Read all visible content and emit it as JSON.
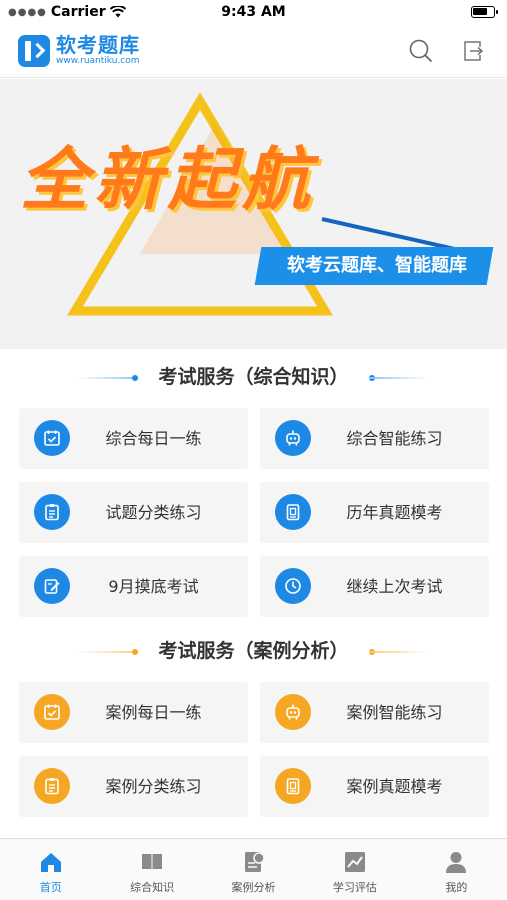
{
  "status_bar": {
    "carrier": "Carrier",
    "time": "9:43 AM"
  },
  "header": {
    "app_name": "软考题库",
    "app_url": "www.ruantiku.com"
  },
  "banner": {
    "headline": "全新起航",
    "subtitle": "软考云题库、智能题库"
  },
  "colors": {
    "brand_blue": "#1e88e5",
    "accent_orange": "#f5a623",
    "tile_bg": "#f5f5f5"
  },
  "section1": {
    "title": "考试服务（综合知识）",
    "tiles": [
      {
        "label": "综合每日一练",
        "icon": "calendar-check-icon"
      },
      {
        "label": "综合智能练习",
        "icon": "robot-icon"
      },
      {
        "label": "试题分类练习",
        "icon": "clipboard-list-icon"
      },
      {
        "label": "历年真题模考",
        "icon": "document-icon"
      },
      {
        "label": "9月摸底考试",
        "icon": "edit-icon"
      },
      {
        "label": "继续上次考试",
        "icon": "clock-icon"
      }
    ]
  },
  "section2": {
    "title": "考试服务（案例分析）",
    "tiles": [
      {
        "label": "案例每日一练",
        "icon": "calendar-check-icon"
      },
      {
        "label": "案例智能练习",
        "icon": "robot-icon"
      },
      {
        "label": "案例分类练习",
        "icon": "clipboard-list-icon"
      },
      {
        "label": "案例真题模考",
        "icon": "document-icon"
      }
    ]
  },
  "tabbar": {
    "items": [
      {
        "label": "首页",
        "icon": "home-icon",
        "active": true
      },
      {
        "label": "综合知识",
        "icon": "book-icon",
        "active": false
      },
      {
        "label": "案例分析",
        "icon": "report-icon",
        "active": false
      },
      {
        "label": "学习评估",
        "icon": "chart-icon",
        "active": false
      },
      {
        "label": "我的",
        "icon": "user-icon",
        "active": false
      }
    ]
  }
}
